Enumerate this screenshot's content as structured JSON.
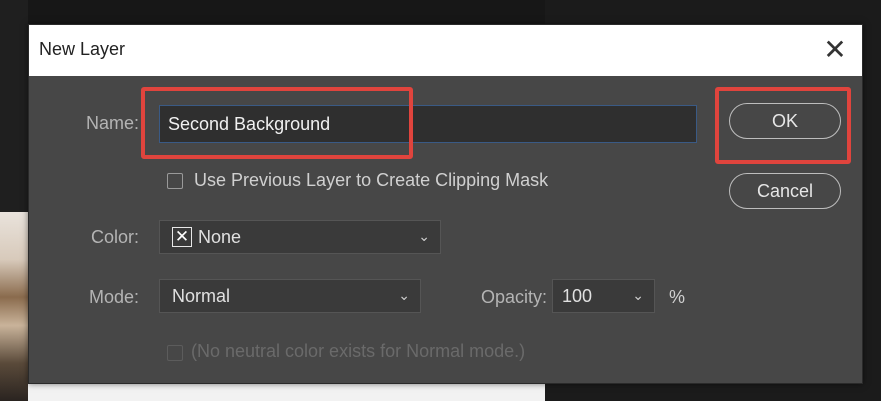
{
  "dialog": {
    "title": "New Layer",
    "close_glyph": "✕",
    "name_label": "Name:",
    "name_value": "Second Background",
    "clipping_mask_label": "Use Previous Layer to Create Clipping Mask",
    "clipping_mask_checked": false,
    "color_label": "Color:",
    "color_value": "None",
    "color_swatch_icon": "x-box-icon",
    "mode_label": "Mode:",
    "mode_value": "Normal",
    "opacity_label": "Opacity:",
    "opacity_value": "100",
    "opacity_unit": "%",
    "neutral_color_label": "(No neutral color exists for Normal mode.)",
    "neutral_color_enabled": false,
    "ok_label": "OK",
    "cancel_label": "Cancel"
  },
  "colors": {
    "dialog_bg": "#474747",
    "highlight": "#e0443d",
    "input_focus_border": "#3a5a85"
  },
  "chevron_glyph": "⌄"
}
